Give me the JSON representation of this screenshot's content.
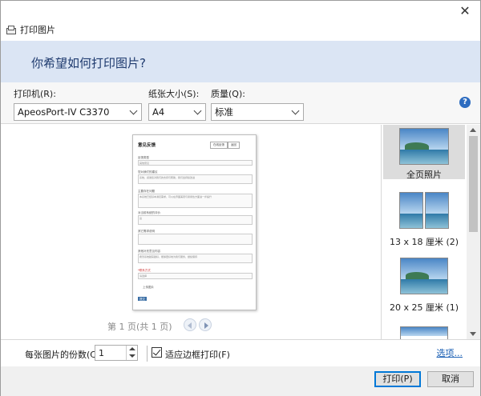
{
  "window": {
    "title": "打印图片",
    "close_glyph": "✕"
  },
  "header": {
    "question": "你希望如何打印图片?",
    "help_glyph": "?"
  },
  "printer": {
    "label": "打印机(R):",
    "value": "ApeosPort-IV C3370"
  },
  "paper": {
    "label": "纸张大小(S):",
    "value": "A4"
  },
  "quality": {
    "label": "质量(Q):",
    "value": "标准"
  },
  "preview": {
    "page_info": "第 1 页(共 1 页)",
    "page": {
      "title": "意见反馈",
      "buttons": [
        "在线反馈",
        "返回"
      ],
      "fields": [
        {
          "label": "反馈类型",
          "value": "其他意见"
        },
        {
          "label": "您对我们的建议",
          "value": "系统，感谢您对我们的支持与帮助，我们会持续改进"
        },
        {
          "label": "主要存在问题",
          "value": "本系统已经基本满足需求，可以在界面美观与易用性方面进一步提升"
        },
        {
          "label": "对当前系统的评价",
          "value": "良"
        },
        {
          "label": "其它需求说明",
          "value": ""
        },
        {
          "label": "其他补充意见内容",
          "value": "希望系统越来越好，能够更好地为我们服务，继续保持"
        }
      ],
      "required_note": "*联系方式",
      "contact": "请选择",
      "submit": "上传图片",
      "primary": "提交"
    }
  },
  "layouts": [
    {
      "label": "全页照片",
      "selected": true
    },
    {
      "label": "13 x 18 厘米 (2)",
      "selected": false
    },
    {
      "label": "20 x 25 厘米 (1)",
      "selected": false
    }
  ],
  "bottom": {
    "copies_label": "每张图片的份数(C):",
    "copies_value": "1",
    "fit_label": "适应边框打印(F)",
    "fit_checked": true,
    "options_link": "选项..."
  },
  "footer": {
    "print": "打印(P)",
    "cancel": "取消"
  }
}
